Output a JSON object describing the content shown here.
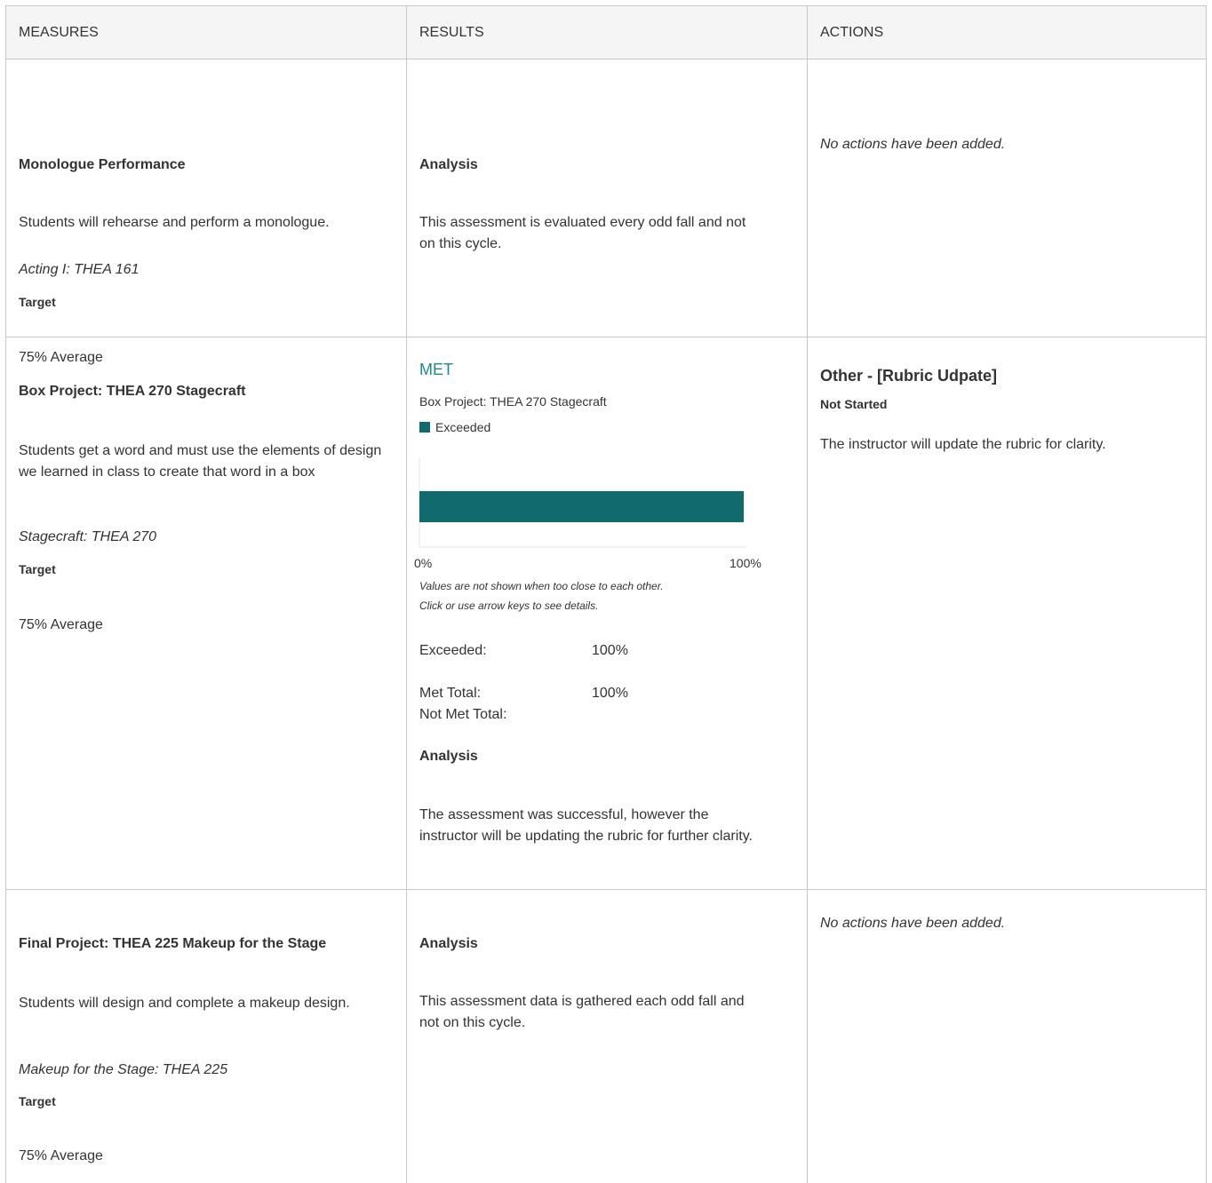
{
  "headers": {
    "measures": "MEASURES",
    "results": "RESULTS",
    "actions": "ACTIONS"
  },
  "rows": [
    {
      "measure": {
        "title": "Monologue Performance",
        "description": "Students will rehearse and perform a monologue.",
        "course": "Acting I: THEA 161",
        "target_label": "Target",
        "target_value": "75% Average"
      },
      "results": {
        "analysis_label": "Analysis",
        "analysis_text": "This assessment is evaluated every odd fall and not on this cycle."
      },
      "actions": {
        "empty_text": "No actions have been added."
      }
    },
    {
      "measure": {
        "title": "Box Project: THEA 270 Stagecraft",
        "description": "Students get a word and must use the elements of design we learned in class to create that word in a box",
        "course": "Stagecraft: THEA 270",
        "target_label": "Target",
        "target_value": "75% Average"
      },
      "results": {
        "status": "MET",
        "chart_title": "Box Project: THEA 270 Stagecraft",
        "legend_label": "Exceeded",
        "axis_min_label": "0%",
        "axis_max_label": "100%",
        "note_line1": "Values are not shown when too close to each other.",
        "note_line2": "Click or use arrow keys to see details.",
        "exceeded_label": "Exceeded:",
        "exceeded_value": "100%",
        "met_total_label": "Met Total:",
        "met_total_value": "100%",
        "not_met_total_label": "Not Met Total:",
        "analysis_label": "Analysis",
        "analysis_text": "The assessment was successful, however the instructor will be updating the rubric for further clarity."
      },
      "actions": {
        "title": "Other - [Rubric Udpate]",
        "status": "Not Started",
        "description": "The instructor will update the rubric for clarity."
      }
    },
    {
      "measure": {
        "title": "Final Project: THEA 225 Makeup for the Stage",
        "description": "Students will design and complete a makeup design.",
        "course": "Makeup for the Stage: THEA 225",
        "target_label": "Target",
        "target_value": "75% Average"
      },
      "results": {
        "analysis_label": "Analysis",
        "analysis_text": "This assessment data is gathered each odd fall and not on this cycle."
      },
      "actions": {
        "empty_text": "No actions have been added."
      }
    }
  ],
  "chart_data": {
    "type": "bar",
    "orientation": "horizontal",
    "categories": [
      "Box Project: THEA 270 Stagecraft"
    ],
    "series": [
      {
        "name": "Exceeded",
        "values": [
          100
        ]
      }
    ],
    "xlim": [
      0,
      100
    ],
    "color": "#116a6e"
  },
  "colors": {
    "met_status": "#1a8a92",
    "bar": "#116a6e",
    "border": "#c8c8c8",
    "header_bg": "#f5f5f5"
  }
}
